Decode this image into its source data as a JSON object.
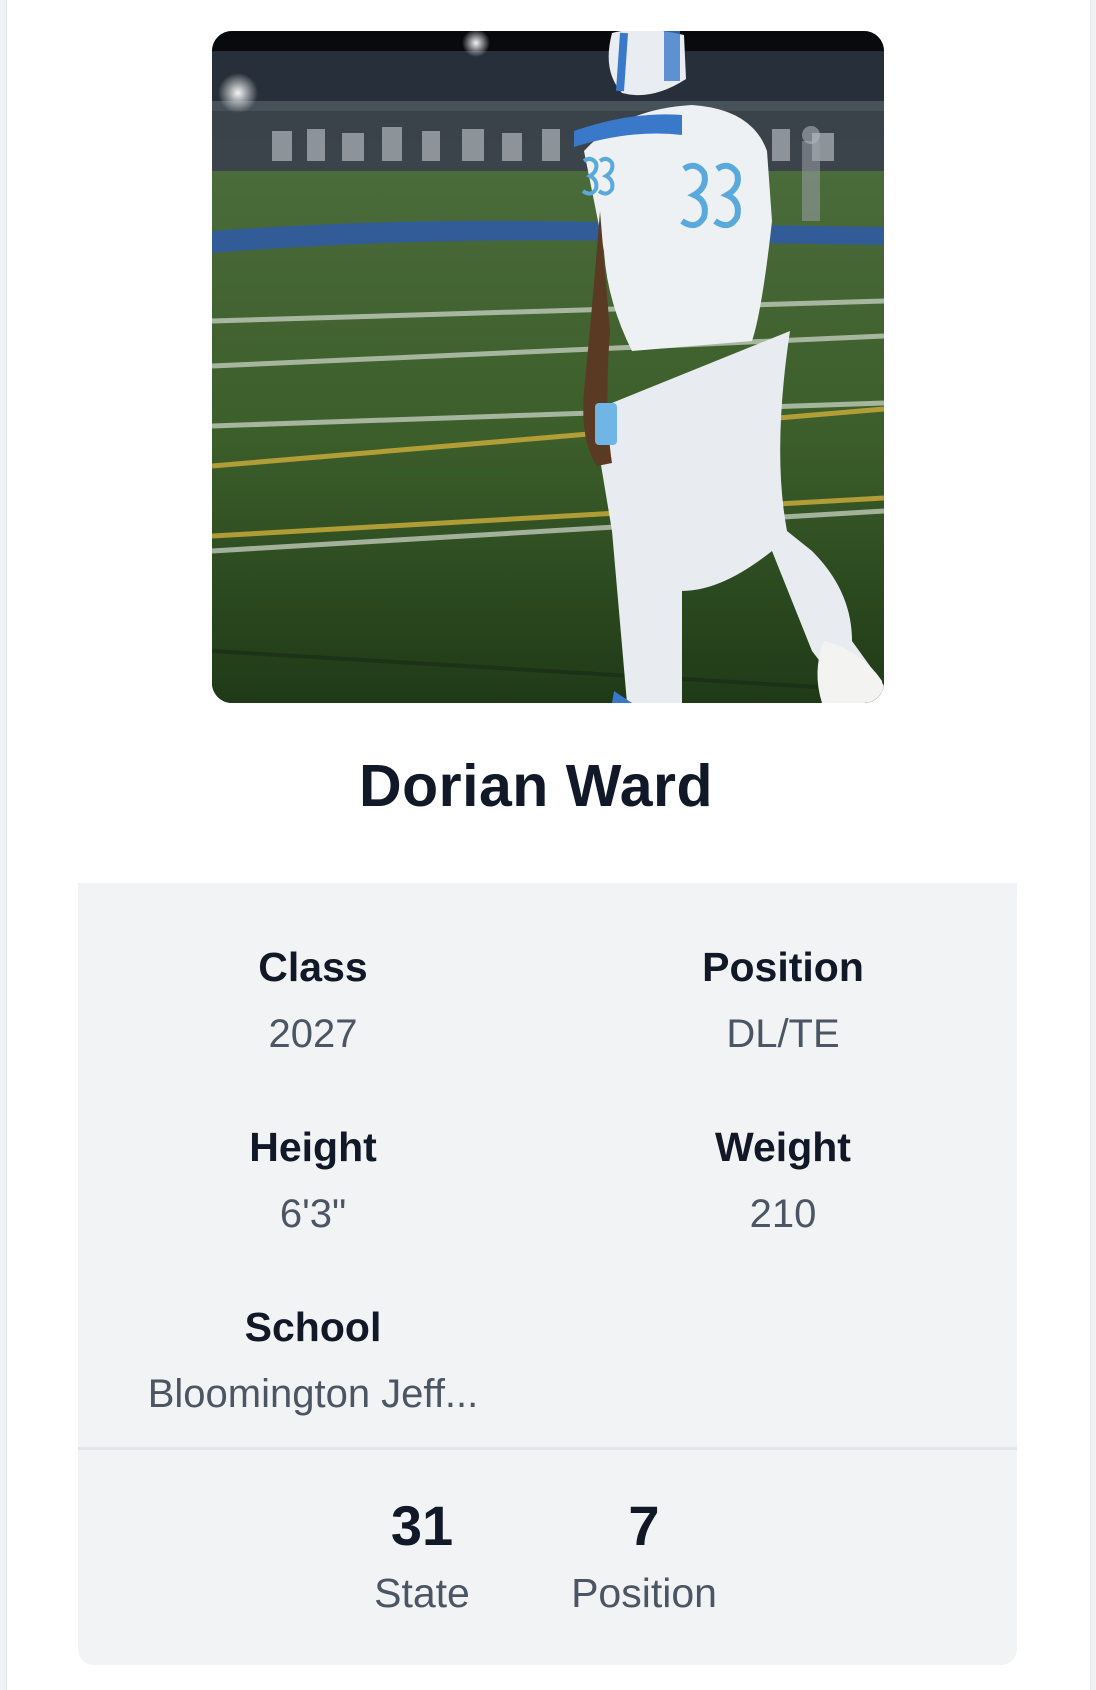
{
  "player": {
    "name": "Dorian Ward",
    "photo_alt": "football-player-photo"
  },
  "attributes": {
    "class": {
      "label": "Class",
      "value": "2027"
    },
    "position": {
      "label": "Position",
      "value": "DL/TE"
    },
    "height": {
      "label": "Height",
      "value": "6'3\""
    },
    "weight": {
      "label": "Weight",
      "value": "210"
    },
    "school": {
      "label": "School",
      "value": "Bloomington Jeff..."
    }
  },
  "rankings": {
    "state": {
      "value": "31",
      "label": "State"
    },
    "position": {
      "value": "7",
      "label": "Position"
    }
  },
  "colors": {
    "card_bg": "#f2f3f5",
    "heading": "#111827",
    "muted": "#4b5563"
  }
}
